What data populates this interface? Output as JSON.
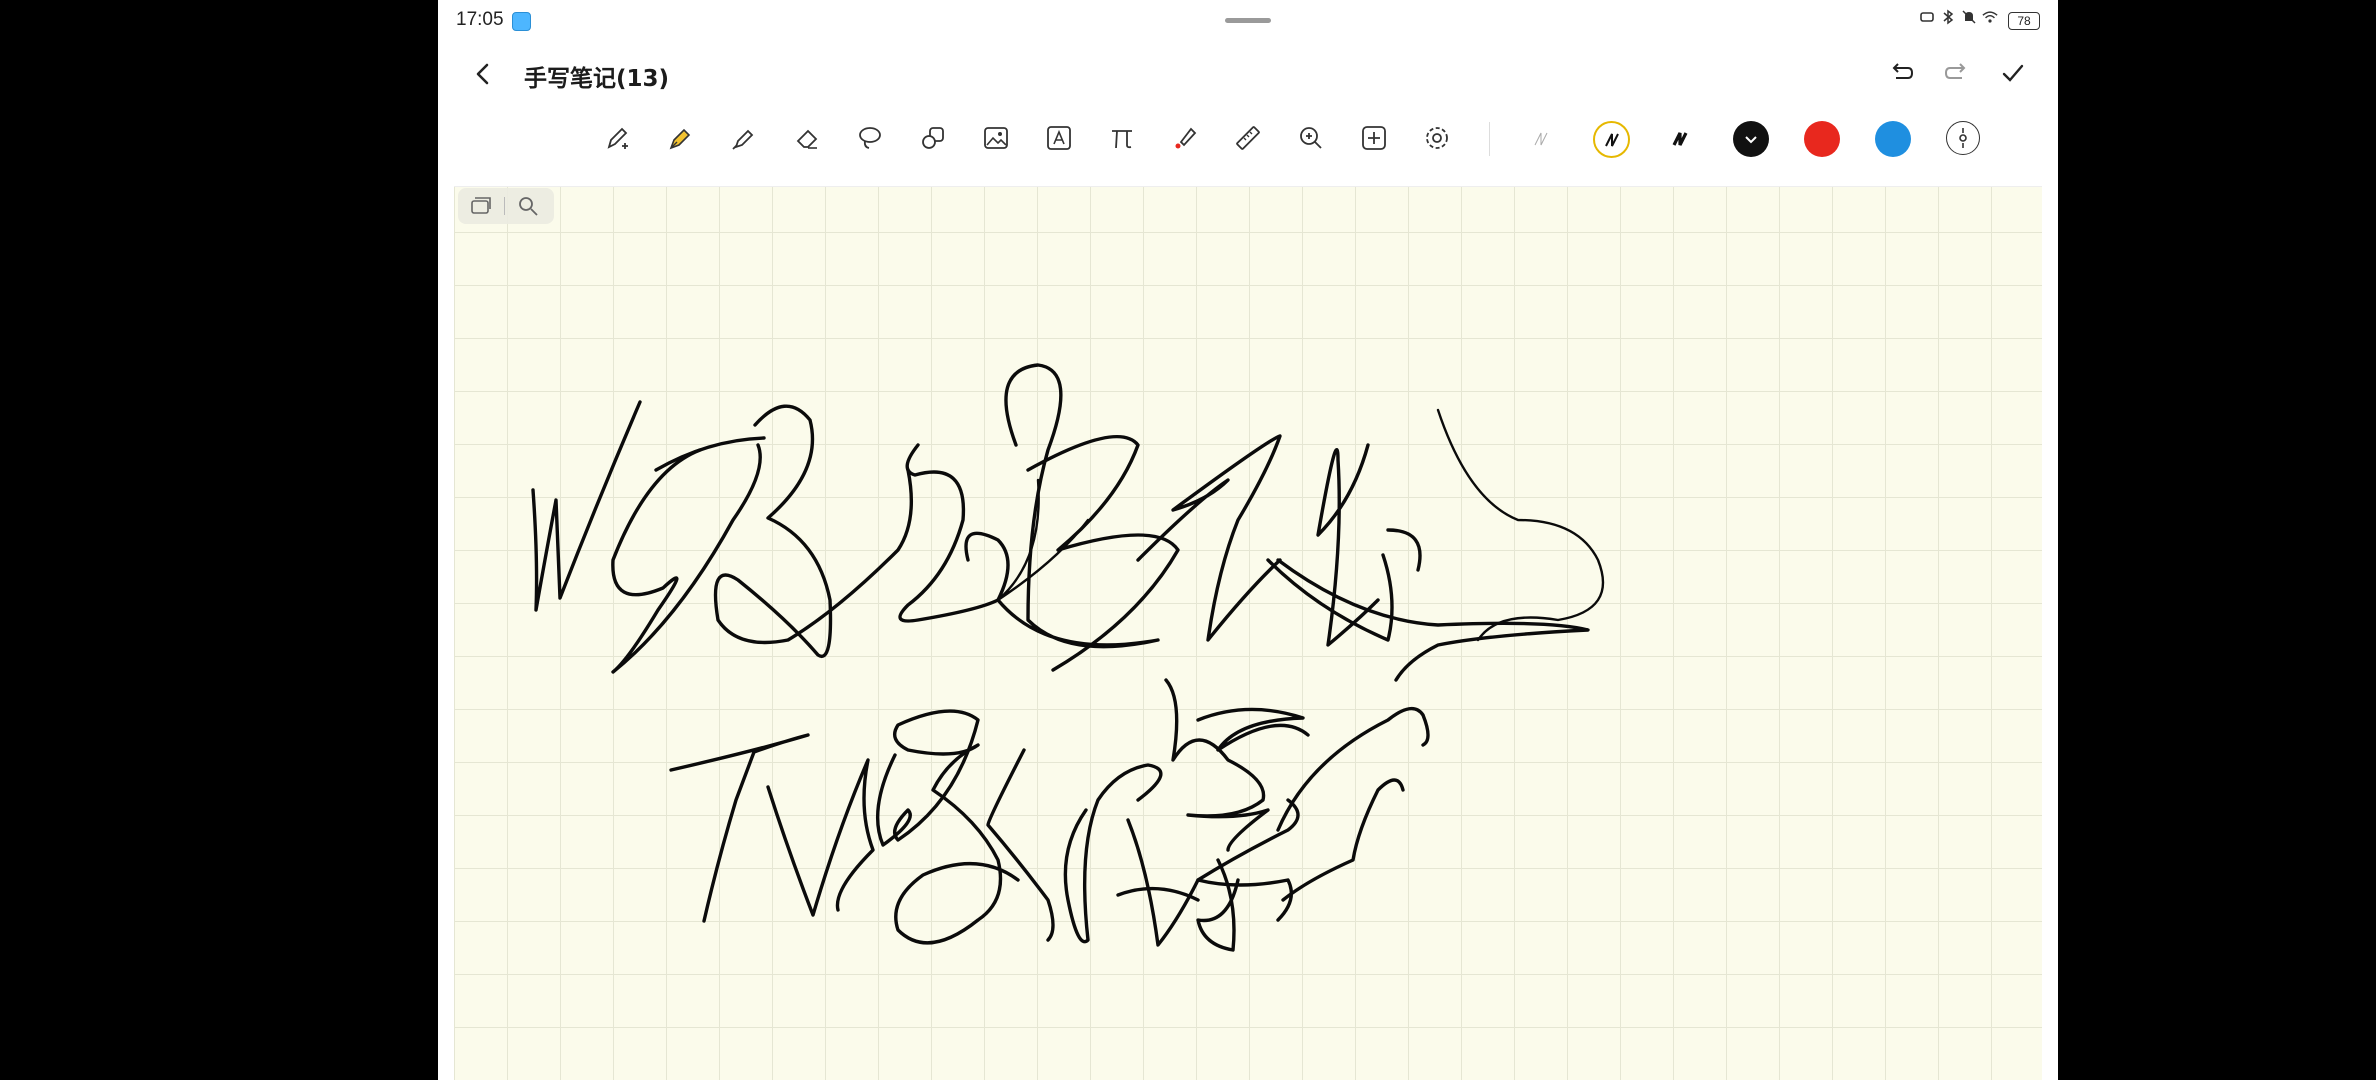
{
  "status_bar": {
    "time": "17:05",
    "battery": "78",
    "icons": [
      "gallery-notification-icon",
      "nfc-icon",
      "bluetooth-icon",
      "mute-icon",
      "wifi-icon",
      "battery-icon"
    ]
  },
  "header": {
    "title": "手写笔记(13)",
    "actions": [
      "undo-icon",
      "redo-icon",
      "check-icon"
    ]
  },
  "toolbar": {
    "tools": [
      "pen-plus-icon",
      "fountain-pen-icon",
      "highlighter-icon",
      "eraser-icon",
      "lasso-icon",
      "shapes-icon",
      "image-icon",
      "text-box-icon",
      "formula-pi-icon",
      "laser-pointer-icon",
      "ruler-icon",
      "zoom-icon",
      "add-page-icon",
      "settings-icon"
    ],
    "stroke_widths": [
      "thin",
      "medium",
      "thick"
    ],
    "colors": {
      "selected_color": "#111111",
      "red": "#e8281e",
      "blue": "#1f8fe0",
      "selected_width_ring": "#e6b800",
      "highlighter_tint": "#f2c230"
    }
  },
  "canvas": {
    "background": "#fbfbeb",
    "grid_color": "#e5e6d3",
    "page_controls": [
      "pages-icon",
      "search-icon"
    ]
  }
}
